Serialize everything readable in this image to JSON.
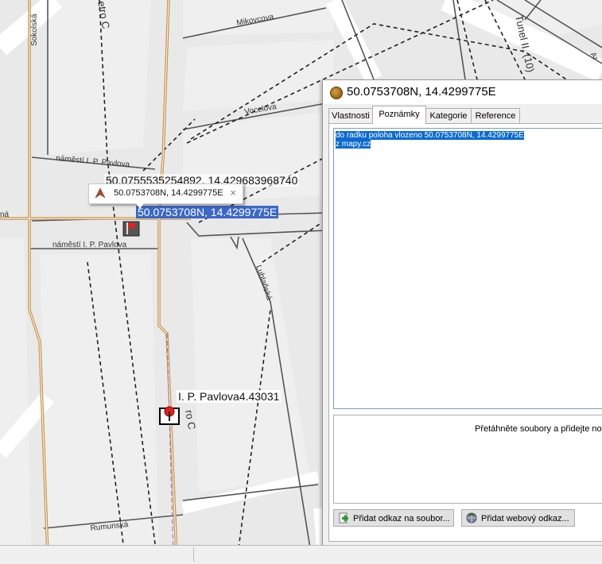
{
  "map": {
    "streets": {
      "sokolska": "Sokolská",
      "mikovcova": "Mikovcova",
      "vocelova": "Vocelova",
      "namesti_top": "náměstí I. P. Pavlova",
      "namesti_bottom": "náměstí I. P. Pavlova",
      "lublanska": "Lublaňská",
      "rumunska": "Rumunská",
      "na_edge": "ná",
      "metro_c_top": "etro C",
      "tunel": "Tunel II. (10)",
      "ar": "Ar",
      "metro_c_bottom": "ro C"
    },
    "coord_label_partial": "50.0755535254892, 14.429683968740",
    "coord_label_selected": "50.0753708N, 14.4299775E",
    "poi_label": "I. P. Pavlova",
    "poi_label_suffix": "4.43031",
    "tooltip": {
      "text": "50.0753708N, 14.4299775E",
      "close": "×"
    }
  },
  "panel": {
    "title": "50.0753708N, 14.4299775E",
    "tabs": [
      "Vlastnosti",
      "Poznámky",
      "Kategorie",
      "Reference"
    ],
    "active_tab": "Poznámky",
    "notes": {
      "line1": "do radku poloha vlozeno 50.0753708N, 14.4299775E",
      "line2": "z mapy.cz"
    },
    "dropzone_text": "Přetáhněte soubory a přidejte nov",
    "buttons": {
      "add_file_link": "Přidat odkaz na soubor...",
      "add_web_link": "Přidat webový odkaz..."
    }
  },
  "colors": {
    "map_bg": "#e9e9e9",
    "main_road": "#c8954a",
    "selection": "#3a67c8"
  }
}
